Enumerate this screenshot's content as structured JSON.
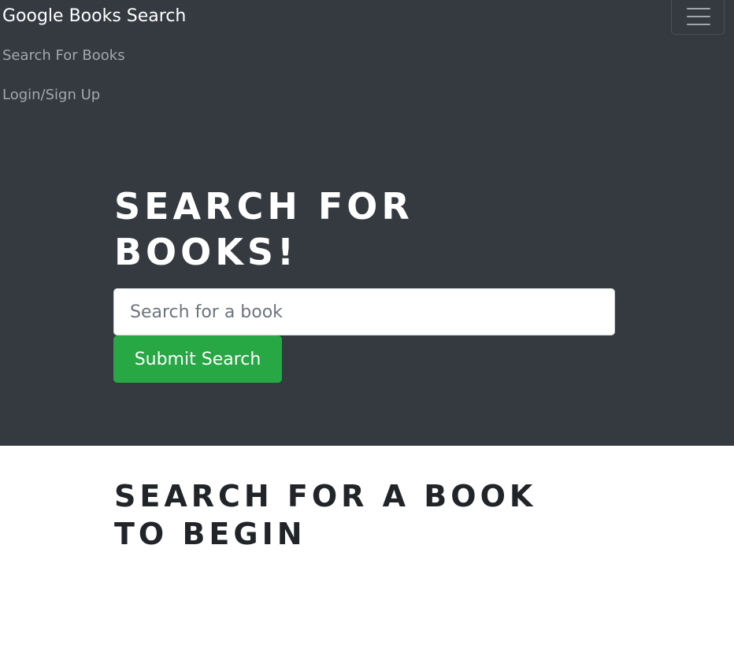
{
  "navbar": {
    "brand": "Google Books Search",
    "links": [
      "Search For Books",
      "Login/Sign Up"
    ],
    "toggler_icon": "hamburger-menu-icon"
  },
  "hero": {
    "title": "Search for Books!",
    "search_placeholder": "Search for a book",
    "search_value": "",
    "submit_label": "Submit Search"
  },
  "results": {
    "heading": "Search for a book to begin"
  },
  "colors": {
    "dark_bg": "#343a40",
    "submit_green": "#28a745",
    "page_bg": "#ffffff"
  }
}
